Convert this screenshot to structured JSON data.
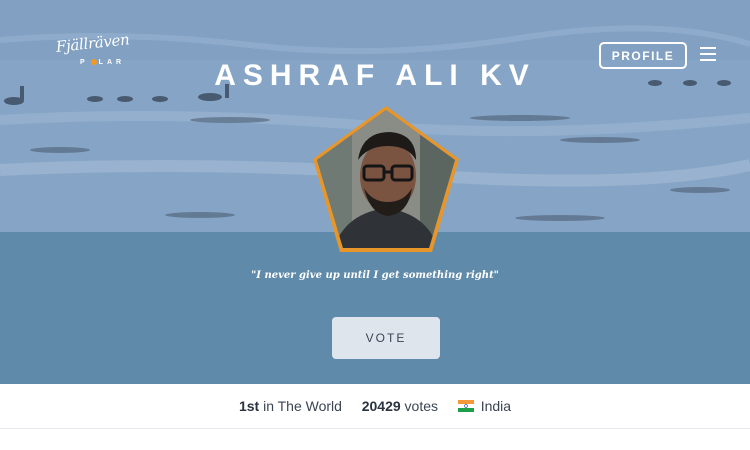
{
  "header": {
    "logo": {
      "line1": "Fjällräven",
      "line2_left": "P",
      "line2_right": "LAR"
    },
    "profile_label": "PROFILE",
    "menu_icon": "hamburger-menu-icon"
  },
  "hero": {
    "name": "ASHRAF ALI KV",
    "quote": "\"I never give up until I get something right\"",
    "vote_label": "VOTE"
  },
  "stats": {
    "rank": "1st",
    "rank_suffix": "in The World",
    "votes": "20429",
    "votes_suffix": "votes",
    "country": "India",
    "flag_icon": "india-flag-icon"
  },
  "colors": {
    "hero_bg": "#5f8aaa",
    "avatar_border": "#e8962a",
    "vote_bg": "#dfe5ec",
    "text_dark": "#3b4452"
  }
}
